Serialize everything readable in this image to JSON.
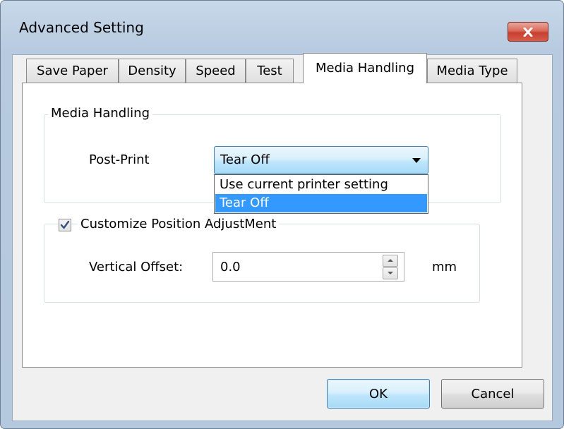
{
  "window": {
    "title": "Advanced Setting"
  },
  "tabs": [
    {
      "label": "Save Paper"
    },
    {
      "label": "Density"
    },
    {
      "label": "Speed"
    },
    {
      "label": "Test"
    },
    {
      "label": "Media Handling",
      "active": true
    },
    {
      "label": "Media Type"
    }
  ],
  "media_handling_group": {
    "legend": "Media Handling",
    "post_print_label": "Post-Print",
    "post_print_value": "Tear Off",
    "options": [
      "Use current printer setting",
      "Tear Off"
    ],
    "selected_option": "Tear Off"
  },
  "position_group": {
    "checkbox_label": "Customize Position AdjustMent",
    "checked": true,
    "vertical_offset_label": "Vertical Offset:",
    "vertical_offset_value": "0.0",
    "unit": "mm"
  },
  "buttons": {
    "ok": "OK",
    "cancel": "Cancel"
  },
  "icons": {
    "close": "close-icon",
    "dropdown": "chevron-down-icon",
    "checkbox": "checkmark-icon",
    "spin_up": "arrow-up-icon",
    "spin_down": "arrow-down-icon"
  },
  "colors": {
    "close_button": "#c7402f",
    "selection": "#3399ff",
    "focus_border": "#3c7fb1"
  }
}
